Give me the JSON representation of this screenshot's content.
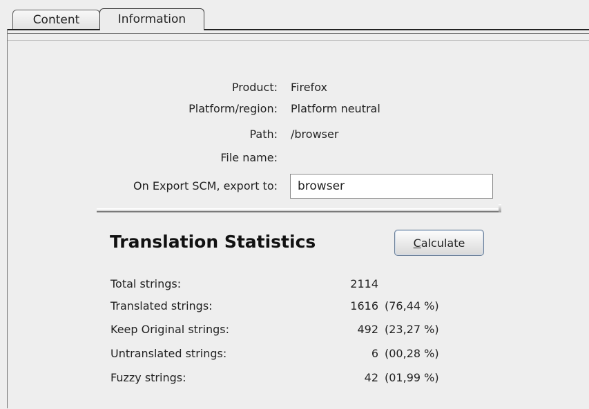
{
  "tabs": [
    {
      "label": "Content",
      "selected": false
    },
    {
      "label": "Information",
      "selected": true
    }
  ],
  "info": {
    "product_label": "Product:",
    "product_value": "Firefox",
    "platform_label": "Platform/region:",
    "platform_value": "Platform neutral",
    "path_label": "Path:",
    "path_value": "/browser",
    "filename_label": "File name:",
    "filename_value": "",
    "export_label": "On Export SCM, export to:",
    "export_value": "browser"
  },
  "stats": {
    "title": "Translation Statistics",
    "calculate_label": "Calculate",
    "calculate_mnemonic": "C",
    "rows": [
      {
        "label": "Total strings:",
        "count": "2114",
        "percent": ""
      },
      {
        "label": "Translated strings:",
        "count": "1616",
        "percent": "(76,44 %)"
      },
      {
        "label": "Keep Original strings:",
        "count": "492",
        "percent": "(23,27 %)"
      },
      {
        "label": "Untranslated strings:",
        "count": "6",
        "percent": "(00,28 %)"
      },
      {
        "label": "Fuzzy strings:",
        "count": "42",
        "percent": "(01,99 %)"
      }
    ]
  }
}
